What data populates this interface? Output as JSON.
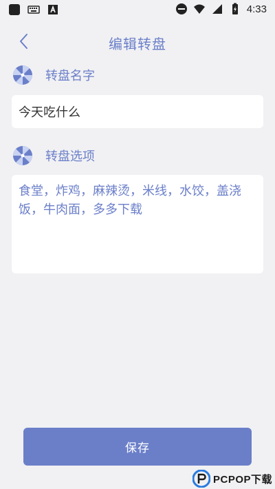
{
  "status_bar": {
    "time": "4:33",
    "left_icons": [
      "app-square-icon",
      "keyboard-icon",
      "notification-a-icon"
    ],
    "right_icons": [
      "dnd-icon",
      "wifi-icon",
      "signal-icon",
      "battery-icon"
    ]
  },
  "header": {
    "title": "编辑转盘",
    "back_icon": "chevron-left-icon"
  },
  "name_section": {
    "label": "转盘名字",
    "icon": "wheel-icon",
    "value": "今天吃什么"
  },
  "options_section": {
    "label": "转盘选项",
    "icon": "wheel-icon",
    "value": "食堂，炸鸡，麻辣烫，米线，水饺，盖浇饭，牛肉面，多多下载"
  },
  "save_button": {
    "label": "保存"
  },
  "watermark": {
    "text": "PCPOP下载"
  },
  "colors": {
    "accent": "#6b7fc9",
    "background": "#f1f1f3",
    "card": "#ffffff"
  }
}
